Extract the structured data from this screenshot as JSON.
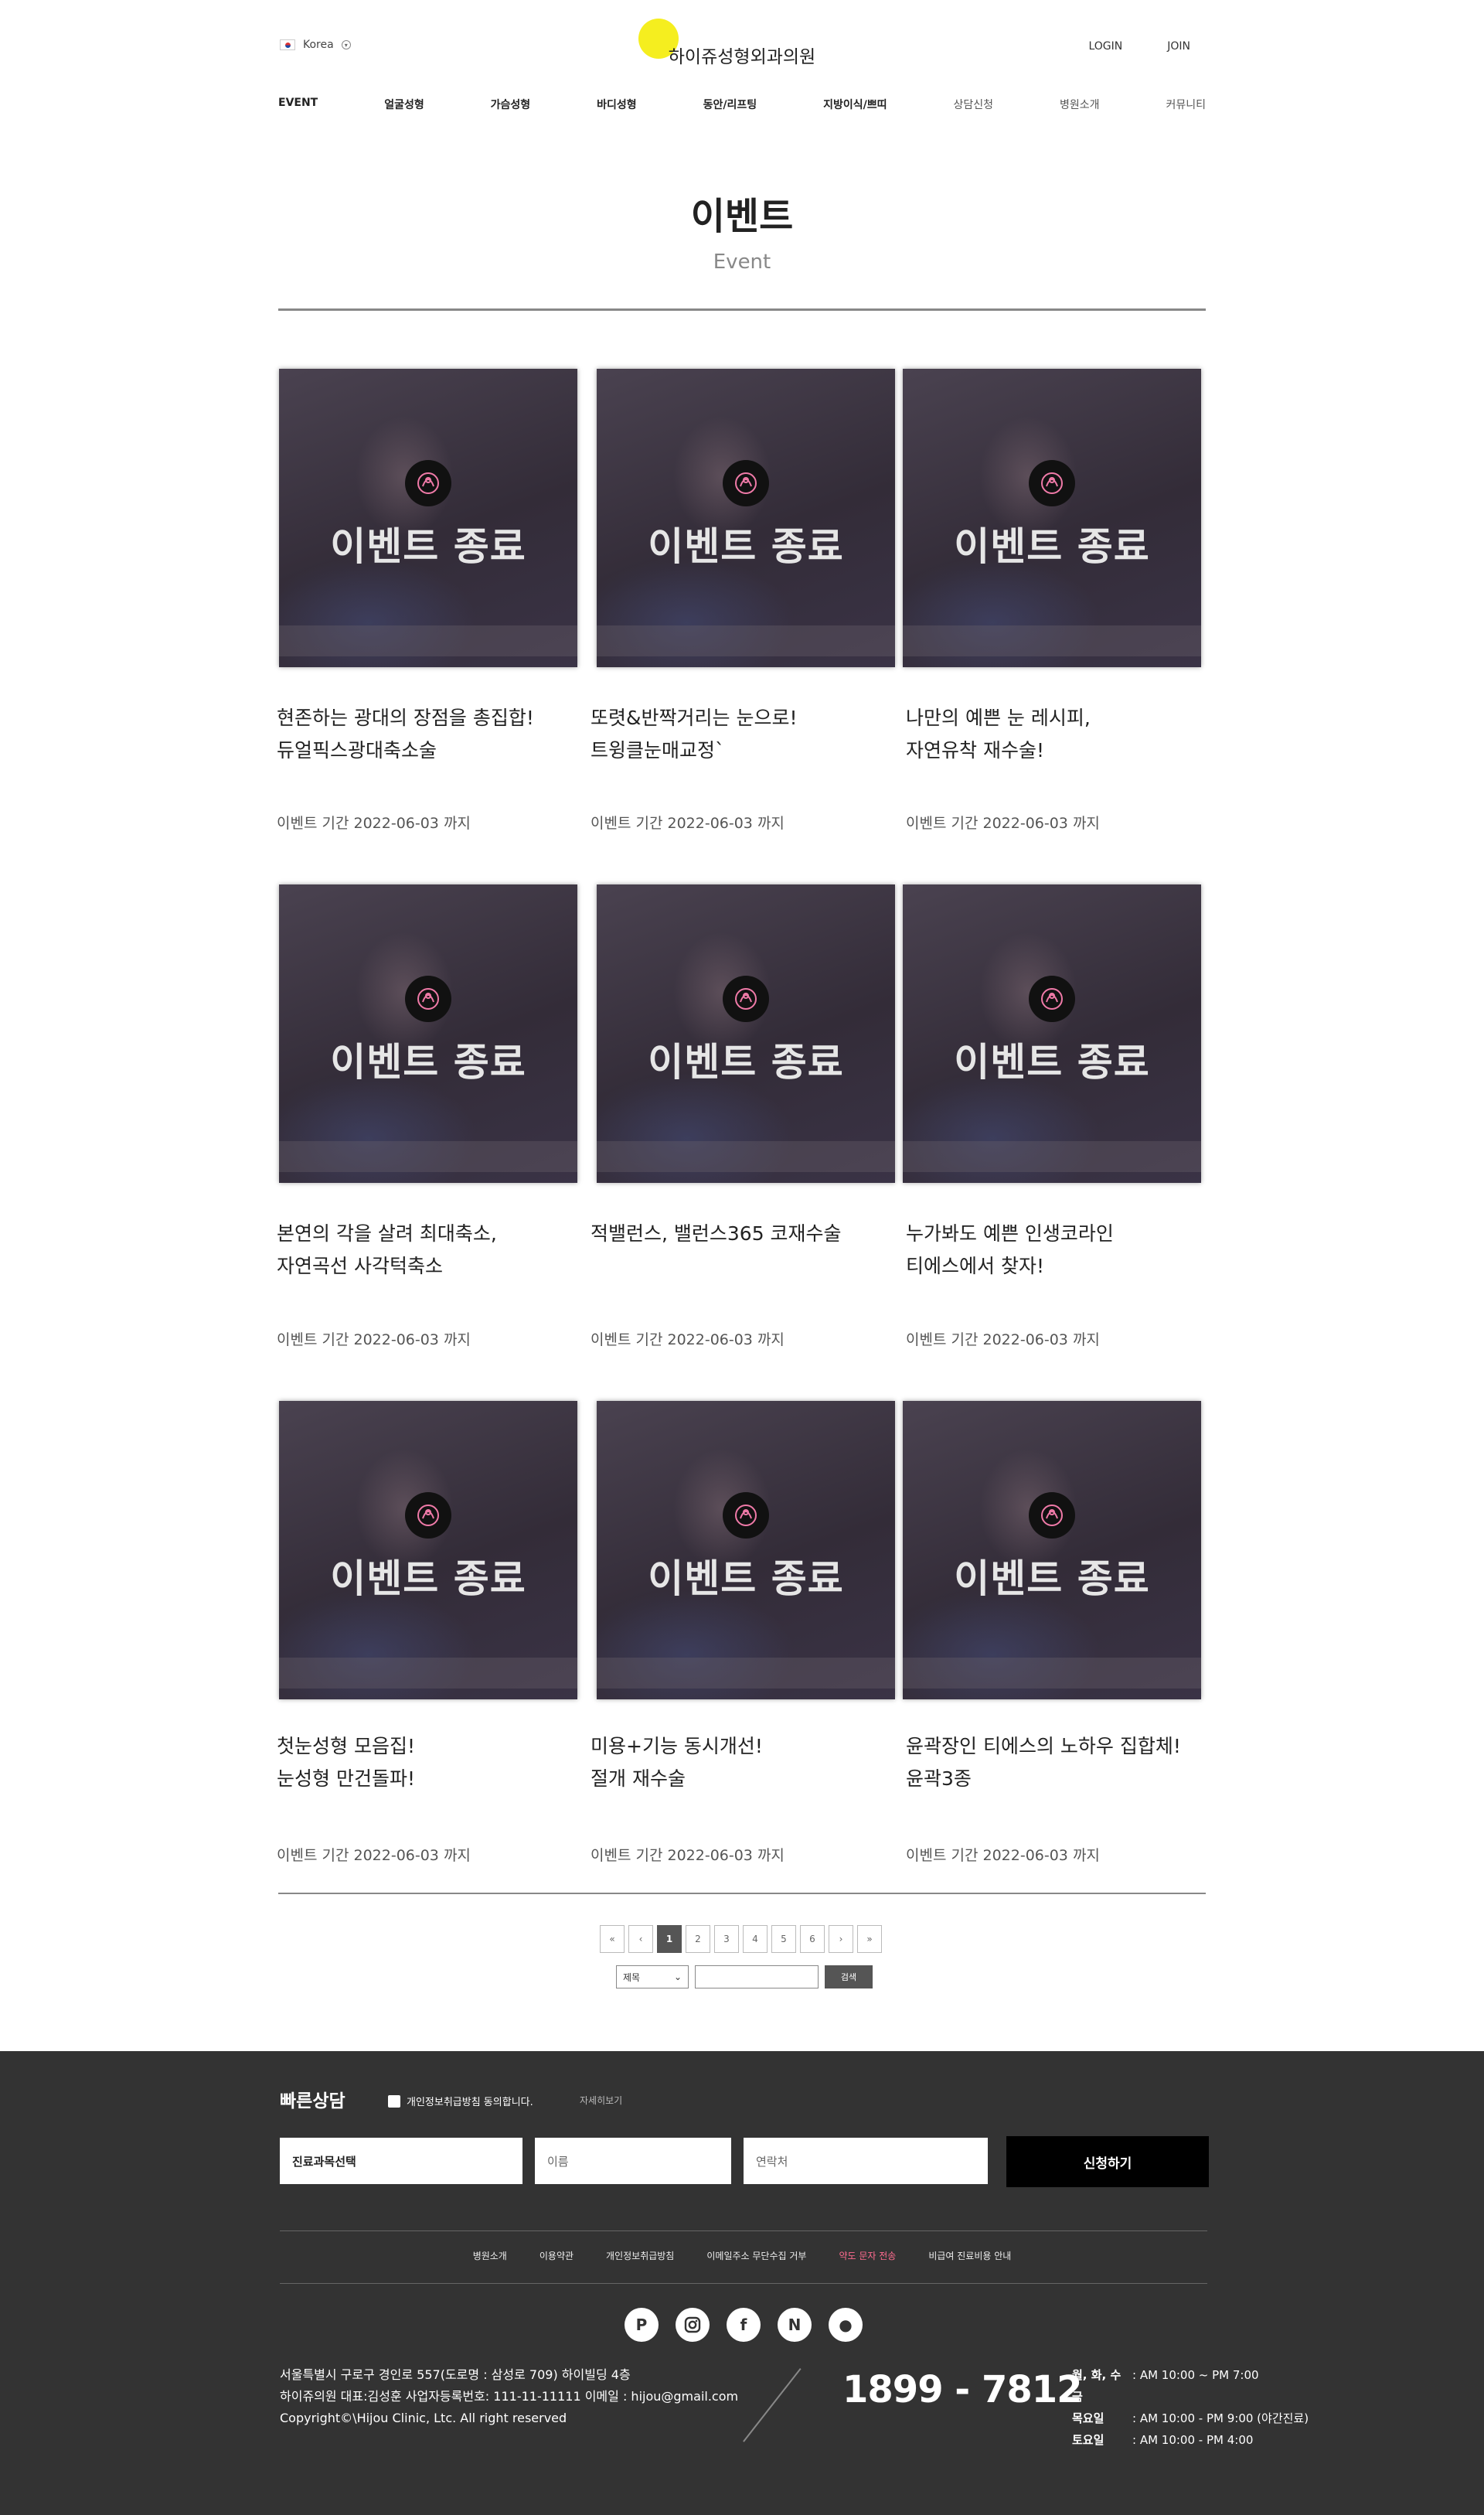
{
  "header": {
    "language": "Korea",
    "logo": "하이쥬성형외과의원",
    "login": "LOGIN",
    "join": "JOIN",
    "nav": [
      "EVENT",
      "얼굴성형",
      "가슴성형",
      "바디성형",
      "동안/리프팅",
      "지방이식/쁘띠",
      "상담신청",
      "병원소개",
      "커뮤니티"
    ]
  },
  "page": {
    "title": "이벤트",
    "subtitle": "Event"
  },
  "events": [
    {
      "overlay": "이벤트 종료",
      "line1": "현존하는 광대의 장점을 총집합!",
      "line2": "듀얼픽스광대축소술",
      "date": "이벤트 기간 2022-06-03 까지"
    },
    {
      "overlay": "이벤트 종료",
      "line1": "또렷&반짝거리는 눈으로!",
      "line2": "트윙클눈매교정`",
      "date": "이벤트 기간 2022-06-03 까지"
    },
    {
      "overlay": "이벤트 종료",
      "line1": "나만의 예쁜 눈 레시피,",
      "line2": "자연유착 재수술!",
      "date": "이벤트 기간 2022-06-03 까지"
    },
    {
      "overlay": "이벤트 종료",
      "line1": "본연의 각을 살려 최대축소,",
      "line2": "자연곡선 사각턱축소",
      "date": "이벤트 기간 2022-06-03 까지"
    },
    {
      "overlay": "이벤트 종료",
      "line1": "적밸런스, 밸런스365 코재수술",
      "line2": "",
      "date": "이벤트 기간 2022-06-03 까지"
    },
    {
      "overlay": "이벤트 종료",
      "line1": "누가봐도 예쁜 인생코라인",
      "line2": "티에스에서 찾자!",
      "date": "이벤트 기간 2022-06-03 까지"
    },
    {
      "overlay": "이벤트 종료",
      "line1": "첫눈성형 모음집!",
      "line2": "눈성형 만건돌파!",
      "date": "이벤트 기간 2022-06-03 까지"
    },
    {
      "overlay": "이벤트 종료",
      "line1": "미용+기능 동시개선!",
      "line2": "절개 재수술",
      "date": "이벤트 기간 2022-06-03 까지"
    },
    {
      "overlay": "이벤트 종료",
      "line1": "윤곽장인 티에스의 노하우 집합체!",
      "line2": "윤곽3종",
      "date": "이벤트 기간 2022-06-03 까지"
    }
  ],
  "pagination": {
    "first": "«",
    "prev": "‹",
    "pages": [
      "1",
      "2",
      "3",
      "4",
      "5",
      "6"
    ],
    "active": "1",
    "next": "›",
    "last": "»",
    "search_field": "제목",
    "search_button": "검색"
  },
  "footer": {
    "quick_title": "빠른상담",
    "agree_label": "개인정보취급방침 동의합니다.",
    "detail_link": "자세히보기",
    "subject_select": "진료과목선택",
    "name_placeholder": "이름",
    "phone_placeholder": "연락처",
    "apply_button": "신청하기",
    "links": [
      "병원소개",
      "이용약관",
      "개인정보취급방침",
      "이메일주소 무단수집 거부",
      "약도 문자 전송",
      "비급여 진료비용 안내"
    ],
    "highlight_link": "약도 문자 전송",
    "address": "서울특별시 구로구 경인로 557(도로명 : 삼성로 709) 하이빌딩 4층",
    "company": "하이쥬의원 대표:김성훈 사업자등록번호: 111-11-11111 이메일 : hijou@gmail.com",
    "copyright": "Copyright©\\Hijou Clinic, Ltc. All right reserved",
    "phone": "1899 - 7812",
    "hours": [
      {
        "day": "월, 화, 수 금",
        "time": ": AM 10:00 ~ PM 7:00"
      },
      {
        "day": "목요일",
        "time": ": AM 10:00 - PM 9:00 (야간진료)"
      },
      {
        "day": "토요일",
        "time": ": AM 10:00 - PM 4:00"
      }
    ]
  },
  "colors": {
    "accent_yellow": "#f5ee1f",
    "footer_bg": "#333333",
    "highlight_pink": "#ff6b8f"
  }
}
